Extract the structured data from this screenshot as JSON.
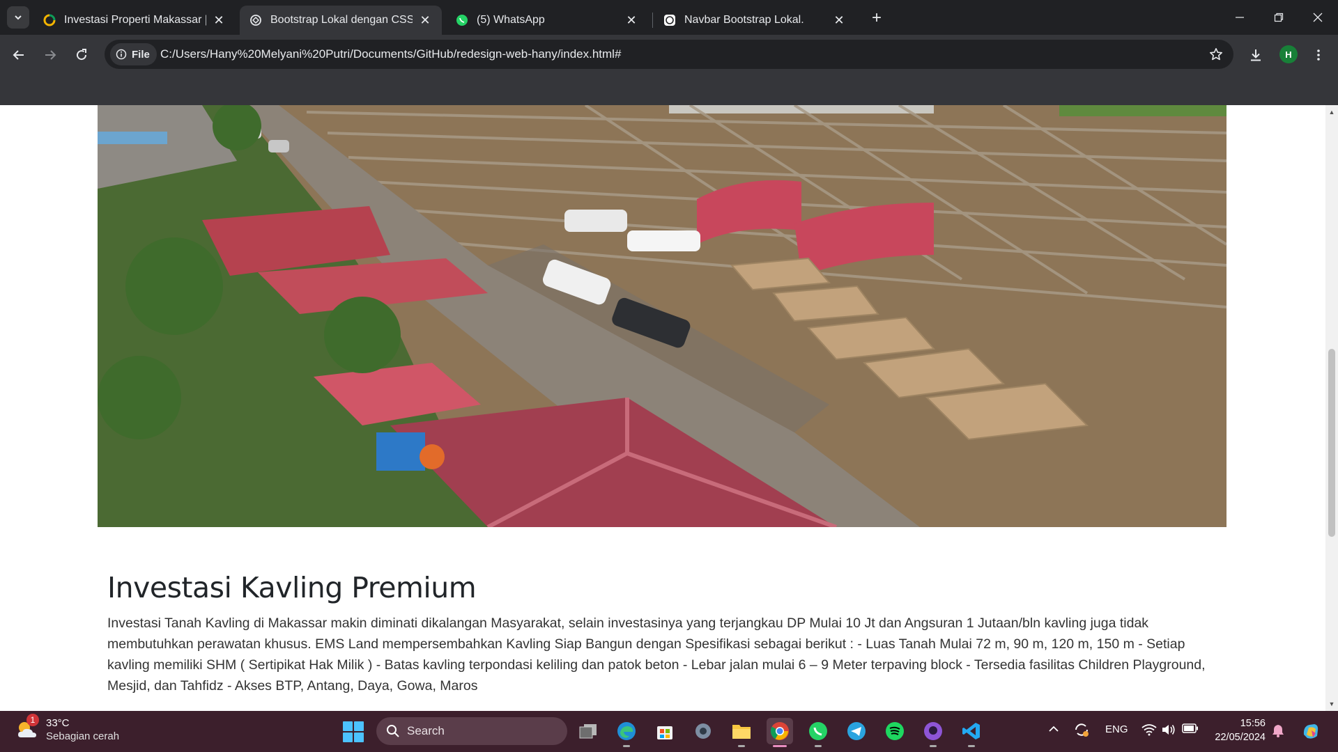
{
  "browser": {
    "tabs": [
      {
        "title": "Investasi Properti Makassar | EMS",
        "favicon": "ems-favicon-icon",
        "active": false
      },
      {
        "title": "Bootstrap Lokal dengan CSS dan JS",
        "favicon": "chatgpt-favicon-icon",
        "active": true
      },
      {
        "title": "(5) WhatsApp",
        "favicon": "whatsapp-favicon-icon",
        "active": false
      },
      {
        "title": "Navbar Bootstrap Lokal.",
        "favicon": "chatgpt-favicon-icon",
        "active": false
      }
    ],
    "chip_label": "File",
    "url": "C:/Users/Hany%20Melyani%20Putri/Documents/GitHub/redesign-web-hany/index.html#",
    "profile_initial": "H"
  },
  "page": {
    "heading": "Investasi Kavling Premium",
    "paragraph": "Investasi Tanah Kavling di Makassar makin diminati dikalangan Masyarakat, selain investasinya yang terjangkau DP Mulai 10 Jt dan Angsuran 1 Jutaan/bln kavling juga tidak membutuhkan perawatan khusus. EMS Land mempersembahkan Kavling Siap Bangun dengan Spesifikasi sebagai berikut : - Luas Tanah Mulai 72 m, 90 m, 120 m, 150 m - Setiap kavling memiliki SHM ( Sertipikat Hak Milik ) - Batas kavling terpondasi keliling dan patok beton - Lebar jalan mulai 6 – 9 Meter terpaving block - Tersedia fasilitas Children Playground, Mesjid, dan Tahfidz - Akses BTP, Antang, Daya, Gowa, Maros"
  },
  "taskbar": {
    "weather_temp": "33°C",
    "weather_condition": "Sebagian cerah",
    "weather_badge": "1",
    "search_label": "Search",
    "language": "ENG",
    "time": "15:56",
    "date": "22/05/2024"
  },
  "colors": {
    "taskbar_bg": "#3c1f2c",
    "browser_dark": "#202124",
    "browser_toolbar": "#35363a"
  }
}
